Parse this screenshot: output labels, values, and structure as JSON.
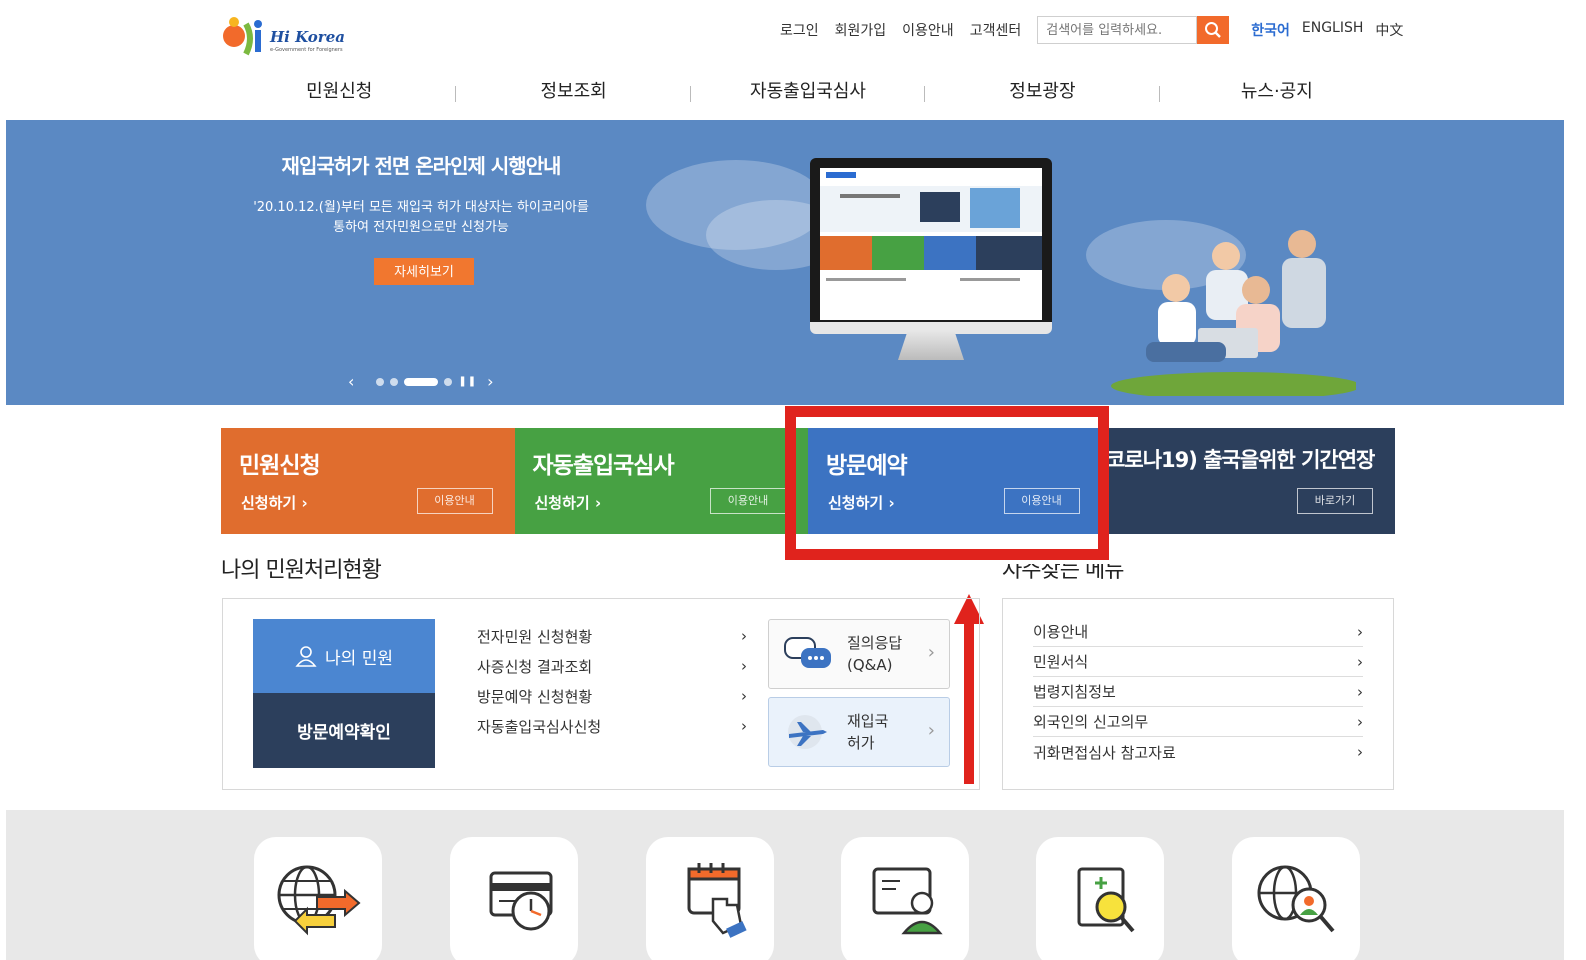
{
  "logo": {
    "brand": "Hi Korea",
    "tagline": "e-Government for Foreigners"
  },
  "util": {
    "links": [
      "로그인",
      "회원가입",
      "이용안내",
      "고객센터"
    ],
    "search_placeholder": "검색어를 입력하세요.",
    "languages": [
      "한국어",
      "ENGLISH",
      "中文"
    ],
    "active_language": "한국어"
  },
  "gnb": [
    "민원신청",
    "정보조회",
    "자동출입국심사",
    "정보광장",
    "뉴스·공지"
  ],
  "banner": {
    "title": "재입국허가 전면 온라인제 시행안내",
    "desc_line1": "'20.10.12.(월)부터 모든 재입국 허가 대상자는 하이코리아를",
    "desc_line2": "통하여 전자민원으로만 신청가능",
    "button": "자세히보기"
  },
  "tiles": [
    {
      "title": "민원신청",
      "apply": "신청하기",
      "guide": "이용안내",
      "color": "#e06d2e"
    },
    {
      "title": "자동출입국심사",
      "apply": "신청하기",
      "guide": "이용안내",
      "color": "#47a143"
    },
    {
      "title": "방문예약",
      "apply": "신청하기",
      "guide": "이용안내",
      "color": "#3c73c2"
    },
    {
      "title": "(코로나19) 출국을위한 기간연장",
      "guide": "바로가기",
      "color": "#2c3f5c"
    }
  ],
  "my_status": {
    "title": "나의 민원처리현황",
    "my_button": "나의 민원",
    "visit_button": "방문예약확인",
    "links": [
      "전자민원 신청현황",
      "사증신청 결과조회",
      "방문예약 신청현황",
      "자동출입국심사신청"
    ],
    "qna_line1": "질의응답",
    "qna_line2": "(Q&A)",
    "reentry_line1": "재입국",
    "reentry_line2": "허가"
  },
  "favorites": {
    "title": "자주찾는 메뉴",
    "items": [
      "이용안내",
      "민원서식",
      "법령지침정보",
      "외국인의 신고의무",
      "귀화면접심사 참고자료"
    ]
  },
  "colors": {
    "accent": "#f26a2b",
    "highlight": "#e0231d",
    "banner_bg": "#5b89c3"
  },
  "quick_icons": [
    "globe-exchange-icon",
    "card-clock-icon",
    "calendar-touch-icon",
    "profile-screen-icon",
    "clipboard-search-icon",
    "globe-person-icon"
  ]
}
